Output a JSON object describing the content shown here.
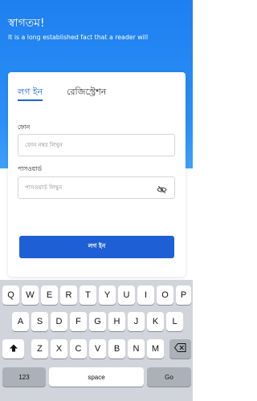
{
  "header": {
    "title": "স্বাগতম!",
    "subtitle": "It is a long established fact that a reader will"
  },
  "tabs": [
    {
      "label": "লগ ইন",
      "active": true
    },
    {
      "label": "রেজিস্ট্রেশন",
      "active": false
    }
  ],
  "form": {
    "phone_label": "ফোন",
    "phone_placeholder": "ফোন নম্বর লিখুন",
    "password_label": "পাসওয়ার্ড",
    "password_placeholder": "পাসওয়ার্ড লিখুন",
    "submit_label": "লগ ইন"
  },
  "keyboard": {
    "row1": [
      "Q",
      "W",
      "E",
      "R",
      "T",
      "Y",
      "U",
      "I",
      "O",
      "P"
    ],
    "row2": [
      "A",
      "S",
      "D",
      "F",
      "G",
      "H",
      "J",
      "K",
      "L"
    ],
    "row3": [
      "Z",
      "X",
      "C",
      "V",
      "B",
      "N",
      "M"
    ],
    "numbers_label": "123",
    "space_label": "space",
    "go_label": "Go",
    "shift_icon": "shift-icon",
    "backspace_icon": "backspace-icon"
  },
  "colors": {
    "header_gradient_start": "#1f7ff0",
    "accent": "#1f64d8",
    "button": "#1f5fd6",
    "keyboard_bg": "#d1d4da"
  }
}
